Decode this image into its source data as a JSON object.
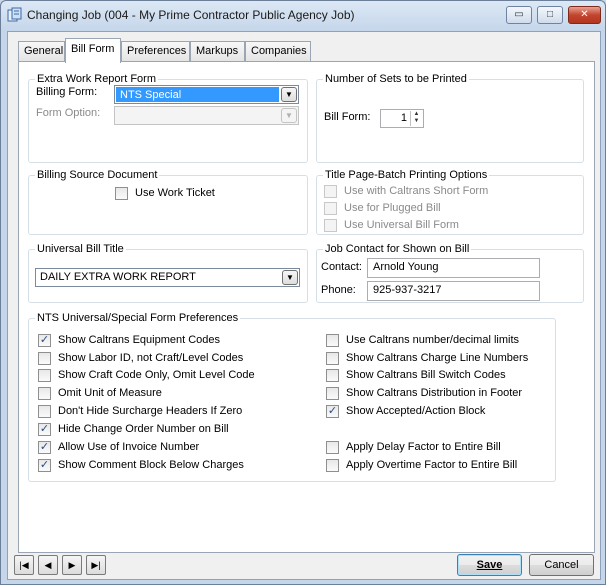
{
  "window": {
    "title": "Changing Job  (004 - My Prime Contractor Public Agency Job)",
    "controls": {
      "minimize": "▭",
      "maximize": "□",
      "close": "✕"
    }
  },
  "tabs": [
    {
      "label": "General"
    },
    {
      "label": "Bill Form",
      "active": true
    },
    {
      "label": "Preferences"
    },
    {
      "label": "Markups"
    },
    {
      "label": "Companies"
    }
  ],
  "extra_work": {
    "title": "Extra Work Report Form",
    "billing_form_label": "Billing Form:",
    "billing_form_value": "NTS Special",
    "form_option_label": "Form Option:",
    "form_option_value": ""
  },
  "sets": {
    "title": "Number of Sets to be Printed",
    "bill_form_label": "Bill Form:",
    "bill_form_value": "1"
  },
  "billing_source": {
    "title": "Billing Source Document",
    "use_work_ticket": {
      "label": "Use Work Ticket",
      "checked": false
    }
  },
  "title_page": {
    "title": "Title Page-Batch Printing Options",
    "options": [
      {
        "label": "Use with Caltrans Short Form",
        "checked": false
      },
      {
        "label": "Use for Plugged Bill",
        "checked": false
      },
      {
        "label": "Use Universal Bill Form",
        "checked": false
      }
    ]
  },
  "universal_title": {
    "title": "Universal Bill Title",
    "value": "DAILY EXTRA WORK REPORT"
  },
  "job_contact": {
    "title": "Job Contact for Shown on Bill",
    "contact_label": "Contact:",
    "contact_value": "Arnold Young",
    "phone_label": "Phone:",
    "phone_value": "925-937-3217"
  },
  "preferences": {
    "title": "NTS Universal/Special Form Preferences",
    "left": [
      {
        "label": "Show Caltrans Equipment Codes",
        "checked": true
      },
      {
        "label": "Show Labor ID, not Craft/Level Codes",
        "checked": false
      },
      {
        "label": "Show Craft Code Only, Omit Level Code",
        "checked": false
      },
      {
        "label": "Omit Unit of Measure",
        "checked": false
      },
      {
        "label": "Don't Hide Surcharge Headers If Zero",
        "checked": false
      },
      {
        "label": "Hide Change Order Number on Bill",
        "checked": true
      },
      {
        "label": "Allow Use of Invoice Number",
        "checked": true
      },
      {
        "label": "Show Comment Block Below Charges",
        "checked": true
      }
    ],
    "right": [
      {
        "label": "Use Caltrans number/decimal limits",
        "checked": false
      },
      {
        "label": "Show Caltrans Charge Line Numbers",
        "checked": false
      },
      {
        "label": "Show Caltrans Bill Switch Codes",
        "checked": false
      },
      {
        "label": "Show Caltrans Distribution in Footer",
        "checked": false
      },
      {
        "label": "Show Accepted/Action Block",
        "checked": true
      },
      {
        "label": "Apply Delay Factor to Entire Bill",
        "checked": false
      },
      {
        "label": "Apply Overtime Factor to Entire Bill",
        "checked": false
      }
    ]
  },
  "navigation": {
    "first": "|◀",
    "prev": "◀",
    "next": "▶",
    "last": "▶|"
  },
  "buttons": {
    "save": "Save",
    "cancel": "Cancel"
  },
  "icons": {
    "check": "✓",
    "dropdown": "▼",
    "spin_up": "▲",
    "spin_down": "▼"
  }
}
